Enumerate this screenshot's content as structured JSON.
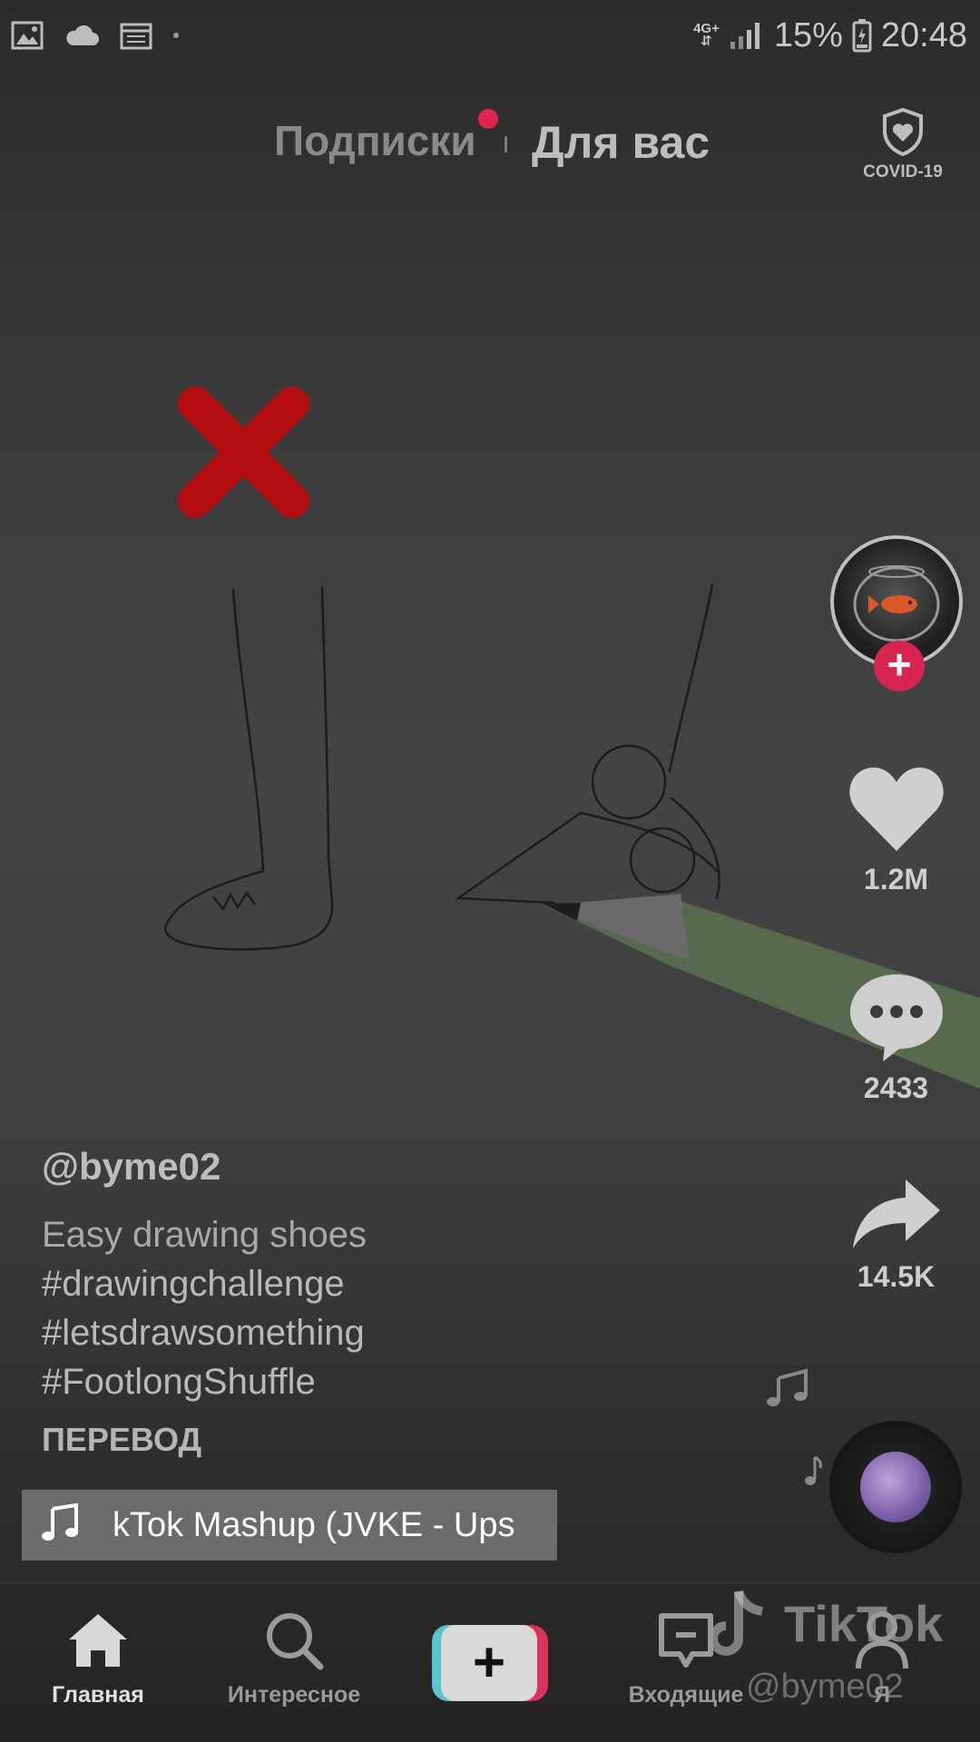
{
  "status_bar": {
    "network_top": "4G+",
    "battery": "15%",
    "time": "20:48"
  },
  "top_tabs": {
    "following": "Подписки",
    "for_you": "Для вас",
    "covid_label": "COVID-19"
  },
  "rail": {
    "likes": "1.2M",
    "comments": "2433",
    "shares": "14.5K"
  },
  "caption": {
    "username": "@byme02",
    "description": "Easy drawing shoes",
    "hashtags": [
      "#drawingchallenge",
      "#letsdrawsomething",
      "#FootlongShuffle"
    ],
    "translate": "ПЕРЕВОД"
  },
  "music": {
    "title": "kTok Mashup (JVKE - Ups"
  },
  "watermark": {
    "brand": "TikTok",
    "user": "@byme02"
  },
  "nav": {
    "home": "Главная",
    "discover": "Интересное",
    "inbox": "Входящие",
    "me": "Я"
  },
  "colors": {
    "accent_red": "#d62550",
    "create_cyan": "#5cc4cc",
    "create_pink": "#d8345c"
  }
}
